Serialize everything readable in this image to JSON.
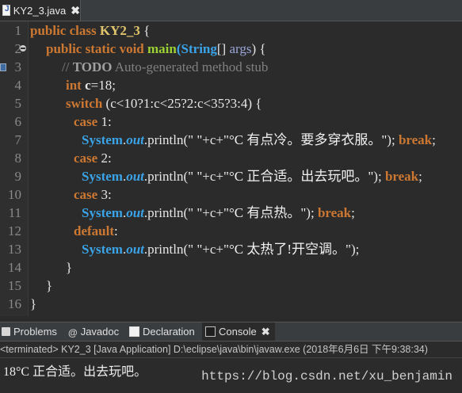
{
  "editor_tab": {
    "label": "KY2_3.java",
    "close": "✖"
  },
  "lines": [
    "1",
    "2",
    "3",
    "4",
    "5",
    "6",
    "7",
    "8",
    "9",
    "10",
    "11",
    "12",
    "13",
    "14",
    "15",
    "16"
  ],
  "code": {
    "l1": {
      "kw1": "public",
      "kw2": "class",
      "cls": "KY2_3",
      "brace": " {"
    },
    "l2": {
      "kw1": "public",
      "kw2": "static",
      "kw3": "void",
      "mth": "main",
      "p1": "(",
      "typ": "String",
      "p2": "[] ",
      "arg": "args",
      "p3": ") {"
    },
    "l3": {
      "cmt1": "// ",
      "todo": "TODO",
      "cmt2": " Auto-generated method stub"
    },
    "l4": {
      "kw": "int",
      "var": "c",
      "eq": "=",
      "num": "18",
      "end": ";"
    },
    "l5": {
      "kw": "switch",
      "expr": "(c<10?1:c<25?2:c<35?3:4) {"
    },
    "l6": {
      "kw": "case",
      "num": "1",
      "colon": ":"
    },
    "l7": {
      "sys": "System",
      "dot1": ".",
      "fld": "out",
      "dot2": ".println(",
      "s1": "\" \"",
      "plus1": "+c+",
      "s2": "\"°C 有点冷。要多穿衣服。\"",
      "close": "); ",
      "kw": "break",
      "end": ";"
    },
    "l8": {
      "kw": "case",
      "num": "2",
      "colon": ":"
    },
    "l9": {
      "sys": "System",
      "dot1": ".",
      "fld": "out",
      "dot2": ".println(",
      "s1": "\" \"",
      "plus1": "+c+",
      "s2": "\"°C 正合适。出去玩吧。\"",
      "close": "); ",
      "kw": "break",
      "end": ";"
    },
    "l10": {
      "kw": "case",
      "num": "3",
      "colon": ":"
    },
    "l11": {
      "sys": "System",
      "dot1": ".",
      "fld": "out",
      "dot2": ".println(",
      "s1": "\" \"",
      "plus1": "+c+",
      "s2": "\"°C 有点热。\"",
      "close": "); ",
      "kw": "break",
      "end": ";"
    },
    "l12": {
      "kw": "default",
      "colon": ":"
    },
    "l13": {
      "sys": "System",
      "dot1": ".",
      "fld": "out",
      "dot2": ".println(",
      "s1": "\" \"",
      "plus1": "+c+",
      "s2": "\"°C 太热了!开空调。\"",
      "close": ");"
    },
    "l14": "}",
    "l15": "}",
    "l16": "}"
  },
  "views": {
    "problems": "Problems",
    "javadoc": "Javadoc",
    "declaration": "Declaration",
    "console": "Console",
    "close": "✖"
  },
  "status": "<terminated> KY2_3 [Java Application] D:\\eclipse\\java\\bin\\javaw.exe (2018年6月6日 下午9:38:34)",
  "console_output": "18°C 正合适。出去玩吧。",
  "watermark": "https://blog.csdn.net/xu_benjamin"
}
